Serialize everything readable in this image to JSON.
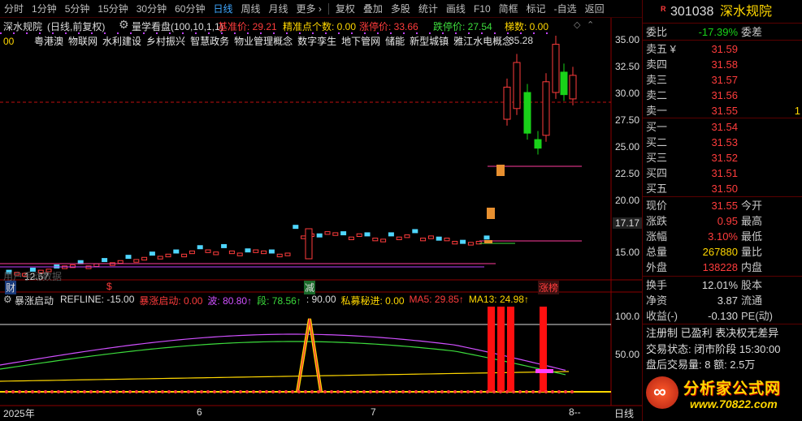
{
  "toolbar": {
    "periods": [
      "分时",
      "1分钟",
      "5分钟",
      "15分钟",
      "30分钟",
      "60分钟",
      "日线",
      "周线",
      "月线",
      "更多 ›"
    ],
    "active_period": "日线",
    "tools": [
      "复权",
      "叠加",
      "多股",
      "统计",
      "画线",
      "F10",
      "简框",
      "标记",
      "-自选",
      "返回"
    ]
  },
  "main_chart": {
    "title_stock": "深水规院",
    "title_mode": "(日线,前复权)",
    "indicator_name": "量学看盘(100,10,1,1)",
    "base_price_label": "基准价: 29.21",
    "precision_label": "精准点个数: 0.00",
    "limit_up_label": "涨停价: 33.66",
    "limit_down_label": "跌停价: 27.54",
    "ladder_label": "梯数: 0.00",
    "leading_code": "00",
    "concepts": [
      "粤港澳",
      "物联网",
      "水利建设",
      "乡村振兴",
      "智慧政务",
      "物业管理概念",
      "数字孪生",
      "地下管网",
      "储能",
      "新型城镇",
      "雅江水电概念"
    ],
    "y_ticks": [
      "35.00",
      "32.50",
      "30.00",
      "27.50",
      "25.00",
      "22.50",
      "20.00",
      "17.17",
      "15.00"
    ],
    "price_marker": "17.17",
    "high_annotation": "35.28",
    "low_annotation": "12.67",
    "watermark": "用户手动数据",
    "markers": {
      "cai": "财",
      "dollar": "$",
      "jian": "减",
      "zhangbang": "涨榜"
    }
  },
  "sub_chart": {
    "name": "暴涨启动",
    "items": [
      {
        "label": "REFLINE: -15.00",
        "color": "#dcdcdc"
      },
      {
        "label": "暴涨启动: 0.00",
        "color": "#ff3c3c"
      },
      {
        "label": "波: 80.80↑",
        "color": "#d050ff"
      },
      {
        "label": "段: 78.56↑",
        "color": "#3cdc3c"
      },
      {
        "label": ": 90.00",
        "color": "#dcdcdc"
      },
      {
        "label": "私募秘进: 0.00",
        "color": "#ffd700"
      },
      {
        "label": "MA5: 29.85↑",
        "color": "#ff3c3c"
      },
      {
        "label": "MA13: 24.98↑",
        "color": "#ffd700"
      }
    ],
    "y_ticks": [
      "100.0",
      "50.00"
    ]
  },
  "x_axis": {
    "labels": [
      "2025年",
      "6",
      "7",
      "8--"
    ],
    "right_label": "日线"
  },
  "quote": {
    "code": "301038",
    "name": "深水规院",
    "weibi_label": "委比",
    "weibi_value": "-17.39%",
    "weicha_label": "委差",
    "asks": [
      {
        "label": "卖五 ¥",
        "price": "31.59"
      },
      {
        "label": "卖四",
        "price": "31.58"
      },
      {
        "label": "卖三",
        "price": "31.57"
      },
      {
        "label": "卖二",
        "price": "31.56"
      },
      {
        "label": "卖一",
        "price": "31.55",
        "vol": "1"
      }
    ],
    "bids": [
      {
        "label": "买一",
        "price": "31.54"
      },
      {
        "label": "买二",
        "price": "31.53"
      },
      {
        "label": "买三",
        "price": "31.52"
      },
      {
        "label": "买四",
        "price": "31.51"
      },
      {
        "label": "买五",
        "price": "31.50"
      }
    ],
    "stats": [
      {
        "k": "现价",
        "v": "31.55",
        "k2": "今开"
      },
      {
        "k": "涨跌",
        "v": "0.95",
        "k2": "最高"
      },
      {
        "k": "涨幅",
        "v": "3.10%",
        "k2": "最低"
      },
      {
        "k": "总量",
        "v": "267880",
        "k2": "量比"
      },
      {
        "k": "外盘",
        "v": "138228",
        "k2": "内盘"
      }
    ],
    "stats2": [
      {
        "k": "换手",
        "v": "12.01%",
        "k2": "股本"
      },
      {
        "k": "净资",
        "v": "3.87",
        "k2": "流通"
      },
      {
        "k": "收益(-)",
        "v": "-0.130",
        "k2": "PE(动)"
      }
    ],
    "tags": "注册制 已盈利 表决权无差异",
    "trade_status": "交易状态: 闭市阶段 15:30:00",
    "after_hours": "盘后交易量: 8  额: 2.5万"
  },
  "ad": {
    "text1": "分析家公式网",
    "text2": "www.70822.com"
  },
  "colors": {
    "up": "#ff3c3c",
    "down": "#19d219",
    "axis": "#8b0000",
    "bg": "#000000",
    "accent": "#3fa7ff"
  }
}
